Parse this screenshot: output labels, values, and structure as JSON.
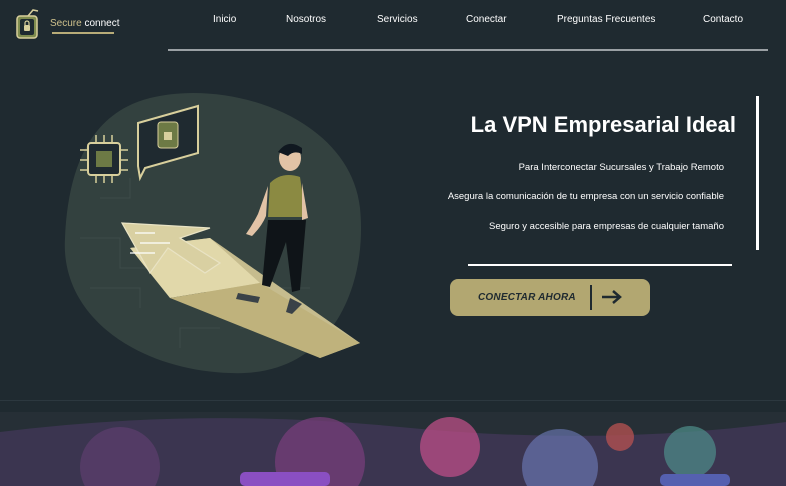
{
  "brand": {
    "name_part1": "Secure",
    "name_part2": "connect",
    "accent_color": "#b2a771"
  },
  "nav": {
    "items": [
      "Inicio",
      "Nosotros",
      "Servicios",
      "Conectar",
      "Preguntas Frecuentes",
      "Contacto"
    ]
  },
  "hero": {
    "title": "La VPN Empresarial Ideal",
    "lines": [
      "Para Interconectar Sucursales y Trabajo Remoto",
      "Asegura la comunicación de tu empresa con un servicio confiable",
      "Seguro y accesible para empresas de cualquier tamaño"
    ],
    "cta_label": "CONECTAR AHORA",
    "cta_icon": "arrow-right-icon"
  },
  "colors": {
    "background": "#1f2a30",
    "accent": "#b2a771"
  }
}
